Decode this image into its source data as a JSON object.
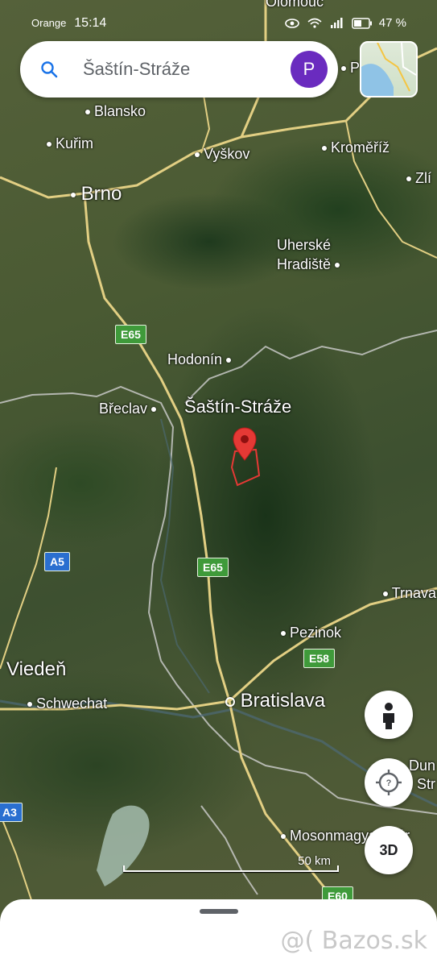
{
  "status_bar": {
    "carrier": "Orange",
    "time": "15:14",
    "battery": "47 %"
  },
  "search": {
    "query": "Šaštín-Stráže",
    "avatar_letter": "P"
  },
  "places": {
    "olomouc": "Olomouc",
    "p_cut": "P",
    "blansko": "Blansko",
    "kurim": "Kuřim",
    "vyskov": "Vyškov",
    "kromeriz": "Kroměříž",
    "zlin": "Zlí",
    "brno": "Brno",
    "uherske": "Uherské",
    "hradiste": "Hradiště",
    "hodonin": "Hodonín",
    "breclav": "Břeclav",
    "sastin": "Šaštín-Stráže",
    "trnava": "Trnava",
    "pezinok": "Pezinok",
    "viden": "Viedeň",
    "schwechat": "Schwechat",
    "bratislava": "Bratislava",
    "duna": "Dun",
    "str": "Str",
    "mosonmagyarovar": "Mosonmagyaróvár"
  },
  "road_shields": {
    "e65_top": "E65",
    "e65_mid": "E65",
    "a5": "A5",
    "e58": "E58",
    "a3": "A3",
    "e60": "E60"
  },
  "controls": {
    "threed_label": "3D",
    "scale_label": "50 km"
  },
  "watermark": "@( Bazos.sk",
  "colors": {
    "pin": "#e53935",
    "avatar": "#6a2bbf",
    "green_shield": "#3f9a3a",
    "blue_shield": "#2a6fd0"
  }
}
